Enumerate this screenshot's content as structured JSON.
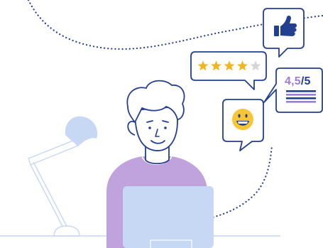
{
  "colors": {
    "outline": "#233f8f",
    "sweater": "#c0a3dd",
    "laptop": "#c6d8f4",
    "lamp_shade": "#c6d8f4",
    "star_filled": "#f2b51f",
    "star_empty": "#d5d5d5",
    "emoji_face": "#f8c635",
    "rating_value": "#9d7bd6",
    "rating_max": "#233f8f"
  },
  "review_card": {
    "rating_value": "4,5",
    "rating_max": "/5"
  },
  "star_bubble": {
    "stars_filled": 4,
    "stars_total": 5
  },
  "icons": [
    "thumbs-up-icon",
    "star-icon",
    "smiley-face-icon"
  ]
}
